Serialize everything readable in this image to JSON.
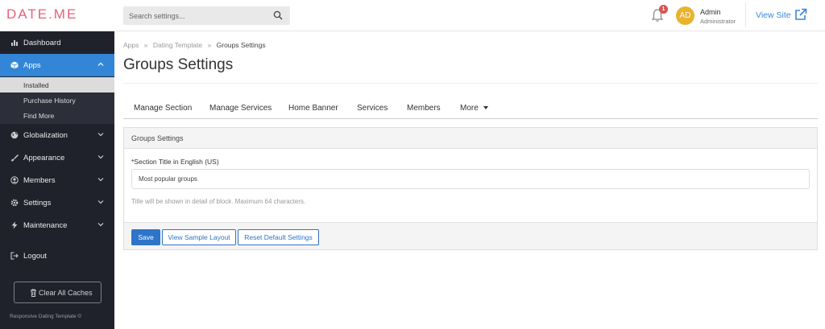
{
  "topbar": {
    "logo": "DATE.ME",
    "search_placeholder": "Search settings...",
    "notification_count": "1",
    "avatar_initials": "AD",
    "user_name": "Admin",
    "user_role": "Administrator",
    "view_site_label": "View Site"
  },
  "sidebar": {
    "items": [
      {
        "label": "Dashboard",
        "icon": "bar-chart-icon"
      },
      {
        "label": "Apps",
        "icon": "cube-icon"
      },
      {
        "label": "Globalization",
        "icon": "globe-icon"
      },
      {
        "label": "Appearance",
        "icon": "brush-icon"
      },
      {
        "label": "Members",
        "icon": "user-circle-icon"
      },
      {
        "label": "Settings",
        "icon": "gear-icon"
      },
      {
        "label": "Maintenance",
        "icon": "bolt-icon"
      },
      {
        "label": "Logout",
        "icon": "logout-icon"
      }
    ],
    "apps_sub": [
      "Installed",
      "Purchase History",
      "Find More"
    ],
    "clear_cache_label": "Clear All Caches",
    "footer": "Responsive Dating Template ©"
  },
  "breadcrumb": [
    "Apps",
    "Dating Template",
    "Groups Settings"
  ],
  "page_title": "Groups Settings",
  "tabs": [
    "Manage Section",
    "Manage Services",
    "Home Banner",
    "Services",
    "Members",
    "More"
  ],
  "panel": {
    "heading": "Groups Settings",
    "field_label": "*Section Title in English (US)",
    "field_value": "Most popular groups",
    "help_text": "Title will be shown in detail of block. Maximum 64 characters.",
    "save_label": "Save",
    "sample_label": "View Sample Layout",
    "reset_label": "Reset Default Settings"
  },
  "colors": {
    "accent": "#3385d6",
    "sidebar_bg": "#20222b",
    "logo": "#e8607a",
    "badge": "#d9534f",
    "avatar": "#e9b32f"
  }
}
